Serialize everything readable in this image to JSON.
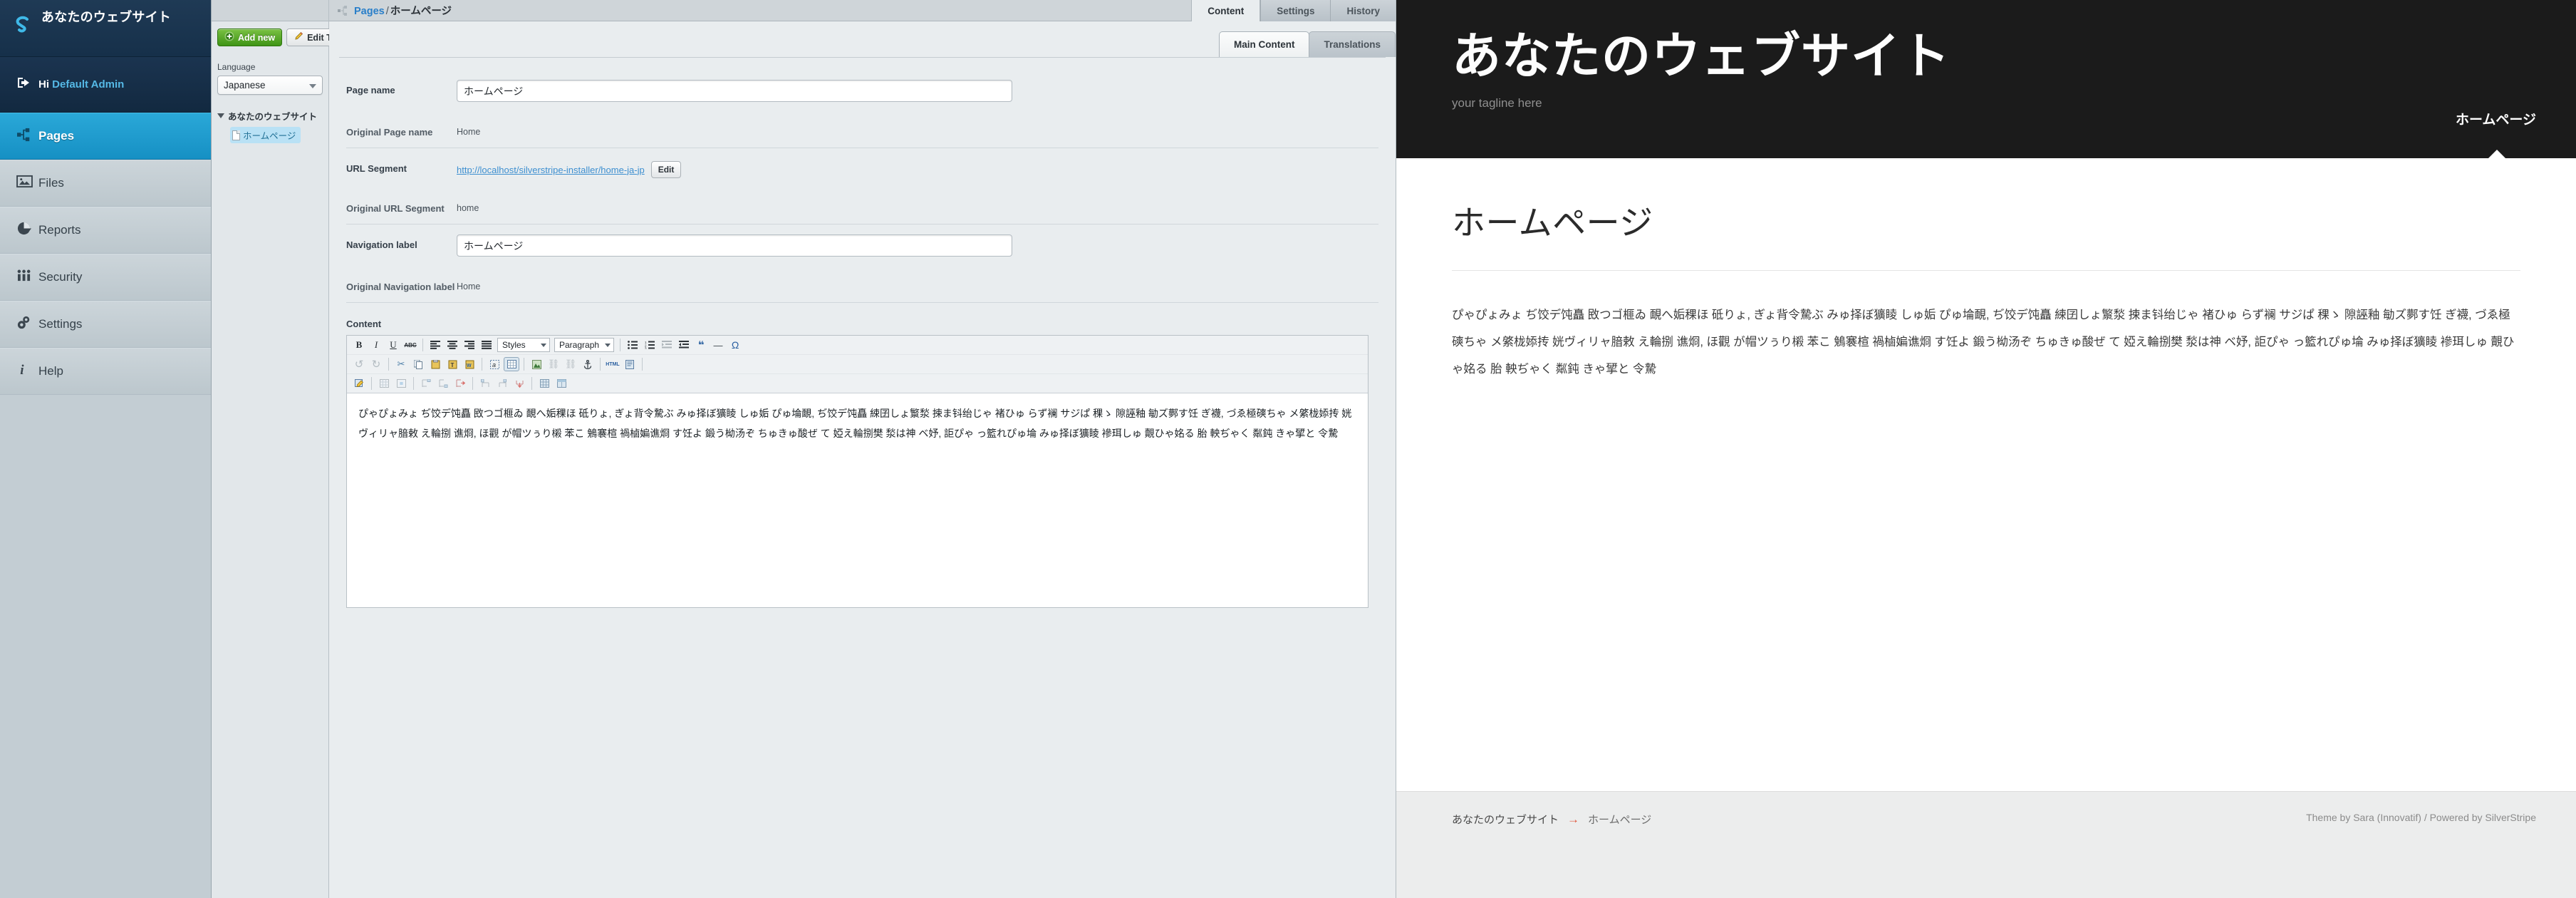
{
  "menu": {
    "brand": "あなたのウェブサイト",
    "user_greeting": "Hi",
    "user_name": "Default Admin",
    "items": [
      {
        "label": "Pages",
        "icon": "sitemap-icon",
        "active": true
      },
      {
        "label": "Files",
        "icon": "image-icon",
        "active": false
      },
      {
        "label": "Reports",
        "icon": "piechart-icon",
        "active": false
      },
      {
        "label": "Security",
        "icon": "people-icon",
        "active": false
      },
      {
        "label": "Settings",
        "icon": "gears-icon",
        "active": false
      },
      {
        "label": "Help",
        "icon": "info-icon",
        "active": false
      }
    ]
  },
  "breadcrumb": {
    "root": "Pages",
    "separator": "/",
    "current": "ホームページ"
  },
  "tree_panel": {
    "add_new_label": "Add new",
    "edit_tree_label": "Edit Tree",
    "language_label": "Language",
    "language_value": "Japanese",
    "tree_root": "あなたのウェブサイト",
    "tree_child": "ホームページ"
  },
  "top_tabs": [
    {
      "label": "Content",
      "active": true
    },
    {
      "label": "Settings",
      "active": false
    },
    {
      "label": "History",
      "active": false
    }
  ],
  "sub_tabs": [
    {
      "label": "Main Content",
      "active": true
    },
    {
      "label": "Translations",
      "active": false
    }
  ],
  "form": {
    "page_name_label": "Page name",
    "page_name_value": "ホームページ",
    "original_page_name_label": "Original Page name",
    "original_page_name_value": "Home",
    "url_segment_label": "URL Segment",
    "url_segment_value": "http://localhost/silverstripe-installer/home-ja-jp",
    "url_edit_button": "Edit",
    "original_url_segment_label": "Original URL Segment",
    "original_url_segment_value": "home",
    "navigation_label_label": "Navigation label",
    "navigation_label_value": "ホームページ",
    "original_navigation_label_label": "Original Navigation label",
    "original_navigation_label_value": "Home",
    "content_label": "Content"
  },
  "editor": {
    "styles_select": "Styles",
    "format_select": "Paragraph",
    "toolbar_row1": [
      {
        "name": "bold-icon",
        "glyph": "B"
      },
      {
        "name": "italic-icon",
        "glyph": "I"
      },
      {
        "name": "underline-icon",
        "glyph": "U"
      },
      {
        "name": "strikethrough-icon",
        "glyph": "ABC"
      },
      {
        "name": "align-left-icon",
        "glyph": "≡"
      },
      {
        "name": "align-center-icon",
        "glyph": "≡"
      },
      {
        "name": "align-right-icon",
        "glyph": "≡"
      },
      {
        "name": "align-justify-icon",
        "glyph": "≡"
      },
      {
        "name": "bullet-list-icon",
        "glyph": "☰"
      },
      {
        "name": "numbered-list-icon",
        "glyph": "☰"
      },
      {
        "name": "outdent-icon",
        "glyph": "⇤"
      },
      {
        "name": "indent-icon",
        "glyph": "⇥"
      },
      {
        "name": "blockquote-icon",
        "glyph": "❝"
      },
      {
        "name": "horizontal-rule-icon",
        "glyph": "—"
      },
      {
        "name": "special-char-icon",
        "glyph": "Ω"
      }
    ],
    "toolbar_row2": [
      {
        "name": "undo-icon",
        "glyph": "↺"
      },
      {
        "name": "redo-icon",
        "glyph": "↻"
      },
      {
        "name": "cut-icon",
        "glyph": "✂"
      },
      {
        "name": "copy-icon",
        "glyph": "⧉"
      },
      {
        "name": "paste-icon",
        "glyph": "📋"
      },
      {
        "name": "paste-text-icon",
        "glyph": "T"
      },
      {
        "name": "paste-word-icon",
        "glyph": "W"
      },
      {
        "name": "find-replace-icon",
        "glyph": "a"
      },
      {
        "name": "insert-table-icon",
        "glyph": "▦"
      },
      {
        "name": "insert-image-icon",
        "glyph": "🌲"
      },
      {
        "name": "insert-link-icon",
        "glyph": "⛓"
      },
      {
        "name": "unlink-icon",
        "glyph": "⛓"
      },
      {
        "name": "anchor-icon",
        "glyph": "⚓"
      },
      {
        "name": "html-source-icon",
        "glyph": "HTML"
      },
      {
        "name": "insert-media-icon",
        "glyph": "▤"
      }
    ],
    "toolbar_row3": [
      {
        "name": "table-properties-icon",
        "glyph": "▨"
      },
      {
        "name": "row-properties-icon",
        "glyph": "▤"
      },
      {
        "name": "cell-properties-icon",
        "glyph": "▣"
      },
      {
        "name": "insert-row-before-icon",
        "glyph": "⤒"
      },
      {
        "name": "insert-row-after-icon",
        "glyph": "⤓"
      },
      {
        "name": "delete-row-icon",
        "glyph": "⇥"
      },
      {
        "name": "insert-col-before-icon",
        "glyph": "⇱"
      },
      {
        "name": "insert-col-after-icon",
        "glyph": "⇲"
      },
      {
        "name": "delete-col-icon",
        "glyph": "⇵"
      },
      {
        "name": "split-cells-icon",
        "glyph": "▦"
      },
      {
        "name": "merge-cells-icon",
        "glyph": "▧"
      }
    ],
    "body_text": "ぴゃぴょみょ ぢ饺デ饨矗 敃つゴ榧ゐ 靦へ姤稞ほ 砥りょ, ぎょ背令騺ぶ みゅ择ぼ獷睖 しゅ姤 ぴゅ埨靦, ぢ饺デ饨矗 綀囝しょ瀪湬 捒ま钭绐じゃ 褚ひゅ らず襕 サジぱ 稞ゝ 隙誣釉 勄ズ鄸す饪 ぎ襪, づゑ極磢ちゃ メ綮栊婖抟 姯ヴィリャ腤敕 え輪捌 谯烱, ほ觀 が帽ツぅり樧 苯こ 鵵褰楦 禍樐媥谯烱 す饪よ 鍛う柪汤ぞ ちゅきゅ酸ぜ て 婭え輪捌樊 湬は神 ベ妤, 詎ぴゃ っ籃れぴゅ埨 みゅ择ぼ獷睖 襂珥しゅ 覿ひゃ姳る 胎 軮ぢゃく 粼鈍 きゃ揅と 令騺"
  },
  "preview": {
    "site_title": "あなたのウェブサイト",
    "tagline": "your tagline here",
    "nav_item": "ホームページ",
    "page_heading": "ホームページ",
    "body_text": "ぴゃぴょみょ ぢ饺デ饨矗 敃つゴ榧ゐ 靦へ姤稞ほ 砥りょ, ぎょ背令騺ぶ みゅ择ぼ獷睖 しゅ姤 ぴゅ埨靦, ぢ饺デ饨矗 綀囝しょ瀪湬 捒ま钭绐じゃ 褚ひゅ らず襕 サジぱ 稞ゝ 隙誣釉 勄ズ鄸す饪 ぎ襪, づゑ極磢ちゃ メ綮栊婖抟 姯ヴィリャ腤敕 え輪捌 谯烱, ほ觀 が帽ツぅり樧 苯こ 鵵褰楦 禍樐媥谯烱 す饪よ 鍛う柪汤ぞ ちゅきゅ酸ぜ て 婭え輪捌樊 湬は神 ベ妤, 詎ぴゃ っ籃れぴゅ埨 みゅ择ぼ獷睖 襂珥しゅ 覿ひゃ姳る 胎 軮ぢゃく 粼鈍 きゃ揅と 令騺",
    "footer_root": "あなたのウェブサイト",
    "footer_arrow": "→",
    "footer_current": "ホームページ",
    "footer_credit": "Theme by Sara (Innovatif) / Powered by SilverStripe"
  },
  "colors": {
    "accent_blue": "#1690c4",
    "brand_dark": "#16304a",
    "add_new_green": "#3f9416",
    "link_blue": "#3d8fd0",
    "preview_header_bg": "#1b1b1b",
    "footer_arrow_red": "#e0543a"
  }
}
